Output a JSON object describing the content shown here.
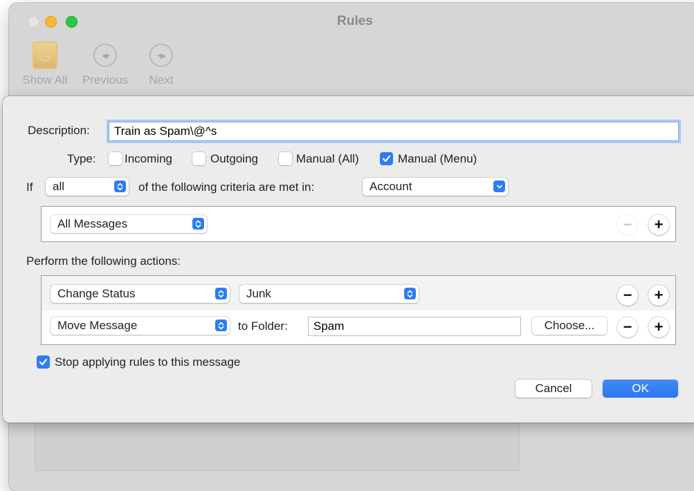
{
  "window": {
    "title": "Rules",
    "toolbar": [
      {
        "label": "Show All",
        "icon": "rules-app-icon"
      },
      {
        "label": "Previous",
        "icon": "previous-arrow-icon"
      },
      {
        "label": "Next",
        "icon": "next-arrow-icon"
      }
    ]
  },
  "sheet": {
    "description_label": "Description:",
    "description_value": "Train as Spam\\@^s",
    "type_label": "Type:",
    "types": [
      {
        "label": "Incoming",
        "checked": false
      },
      {
        "label": "Outgoing",
        "checked": false
      },
      {
        "label": "Manual (All)",
        "checked": false
      },
      {
        "label": "Manual (Menu)",
        "checked": true
      }
    ],
    "criteria": {
      "if_label": "If",
      "match_value": "all",
      "mid_text": "of the following criteria are met in:",
      "scope_value": "Account",
      "rows": [
        {
          "value": "All Messages"
        }
      ]
    },
    "actions_label": "Perform the following actions:",
    "actions": [
      {
        "action": "Change Status",
        "param": "Junk"
      },
      {
        "action": "Move Message",
        "to_folder_label": "to Folder:",
        "folder": "Spam",
        "choose_label": "Choose..."
      }
    ],
    "stop_label": "Stop applying rules to this message",
    "stop_checked": true,
    "cancel_label": "Cancel",
    "ok_label": "OK"
  },
  "colors": {
    "accent": "#2d7cf6",
    "focus_ring": "#a9c8f4"
  }
}
